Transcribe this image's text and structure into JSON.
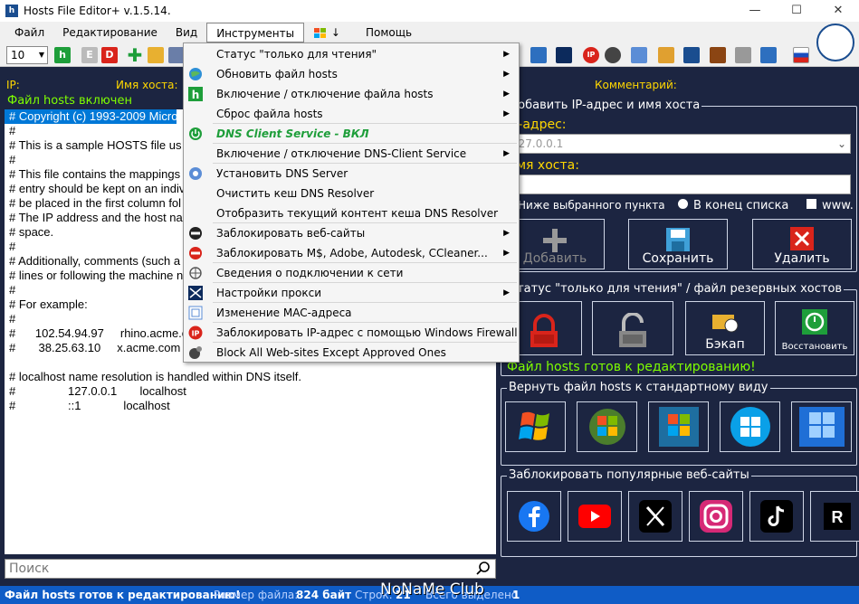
{
  "window": {
    "title": "Hosts File Editor+ v.1.5.14.",
    "app_icon": "h",
    "minimize": "—",
    "maximize": "☐",
    "close": "✕"
  },
  "menu": [
    {
      "label": "Файл"
    },
    {
      "label": "Редактирование"
    },
    {
      "label": "Вид"
    },
    {
      "label": "Инструменты"
    },
    {
      "label": "Помощь"
    }
  ],
  "menu_windows_arrow": "↓",
  "toolbar": {
    "font_size": "10",
    "btn_h": "h",
    "btn_e": "E",
    "btn_d": "D"
  },
  "columns": {
    "ip": "IP:",
    "host": "Имя хоста:",
    "comment": "Комментарий:"
  },
  "editor": {
    "status": "Файл hosts включен",
    "lines": [
      "# Copyright (c) 1993-2009 Micros",
      "#",
      "# This is a sample HOSTS file us",
      "#",
      "# This file contains the mappings",
      "# entry should be kept on an indiv",
      "# be placed in the first column fol",
      "# The IP address and the host na",
      "# space.",
      "#",
      "# Additionally, comments (such a",
      "# lines or following the machine n",
      "#",
      "# For example:",
      "#",
      "#      102.54.94.97     rhino.acme.co",
      "#       38.25.63.10     x.acme.com",
      "",
      "# localhost name resolution is handled within DNS itself.",
      "#                127.0.0.1       localhost",
      "#                ::1             localhost"
    ]
  },
  "search": {
    "placeholder": "Поиск"
  },
  "dropdown": [
    {
      "label": "Статус \"только для чтения\"",
      "arrow": true,
      "icon": "none"
    },
    {
      "label": "Обновить файл hosts",
      "arrow": true,
      "icon": "globe-icon"
    },
    {
      "label": "Включение / отключение файла hosts",
      "arrow": true,
      "icon": "hosts-h-icon"
    },
    {
      "label": "Сброс файла hosts",
      "arrow": true,
      "icon": "none"
    },
    {
      "label": "DNS Client Service - ВКЛ",
      "arrow": false,
      "icon": "power-on-icon",
      "green": true
    },
    {
      "label": "Включение / отключение DNS-Client Service",
      "arrow": true,
      "icon": "none"
    },
    {
      "label": "Установить DNS Server",
      "arrow": false,
      "icon": "dns-server-icon"
    },
    {
      "label": "Очистить кеш DNS Resolver",
      "arrow": false,
      "icon": "none"
    },
    {
      "label": "Отобразить текущий контент кеша DNS Resolver",
      "arrow": false,
      "icon": "none"
    },
    {
      "label": "Заблокировать веб-сайты",
      "arrow": true,
      "icon": "block-icon"
    },
    {
      "label": "Заблокировать M$, Adobe, Autodesk, CCleaner...",
      "arrow": true,
      "icon": "block-red-icon"
    },
    {
      "label": "Сведения о подключении к сети",
      "arrow": false,
      "icon": "network-icon"
    },
    {
      "label": "Настройки прокси",
      "arrow": true,
      "icon": "proxy-icon"
    },
    {
      "label": "Изменение MAC-адреса",
      "arrow": false,
      "icon": "mac-icon"
    },
    {
      "label": "Заблокировать IP-адрес с помощью Windows Firewall",
      "arrow": false,
      "icon": "ip-block-icon"
    },
    {
      "label": "Block All Web-sites Except Approved Ones",
      "arrow": false,
      "icon": "globe-dark-icon"
    }
  ],
  "add_group": {
    "title": "Добавить IP-адрес и имя хоста",
    "ip_label": "IP-адрес:",
    "ip_value": "127.0.0.1",
    "host_label": "Имя хоста:",
    "opt_below": "Ниже выбранного пункта",
    "opt_end": "В конец списка",
    "opt_www": "www.",
    "btn_add": "Добавить",
    "btn_save": "Сохранить",
    "btn_delete": "Удалить"
  },
  "status_group": {
    "title": "Статус \"только для чтения\" / файл резервных хостов",
    "btn_backup": "Бэкап",
    "btn_restore": "Восстановить",
    "ready": "Файл hosts готов к редактированию!"
  },
  "restore_group": {
    "title": "Вернуть файл hosts к стандартному виду",
    "xp": "Windows XP",
    "vista": "Vista",
    "seven": "Windows 7",
    "eight": "Windows 8",
    "ten": "Windows 10, 11"
  },
  "block_group": {
    "title": "Заблокировать популярные веб-сайты"
  },
  "statusbar": {
    "ready": "Файл hosts готов к редактированию!",
    "size_label": "Размер файла:",
    "size_value": "824 байт",
    "lines_label": "Строк:",
    "lines_value": "21",
    "selected_label": "Всего выделено",
    "selected_value": "1"
  },
  "watermark": "NoNaMe Club",
  "colors": {
    "bg": "#1c2541",
    "yellow": "#ffd700",
    "green": "#7fff00",
    "status": "#0f5cc6",
    "select": "#0078d7"
  }
}
